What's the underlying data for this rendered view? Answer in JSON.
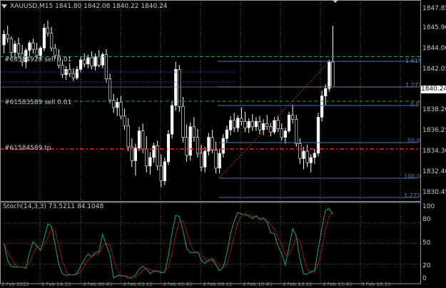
{
  "header": {
    "symbol_line": "XAUUSD,M15  1841.80 1842.08 1840.22 1840.24",
    "menu_icon": "triangle-down-icon"
  },
  "price_axis": {
    "labels": [
      "1847.85",
      "1845.90",
      "1844.00",
      "1842.05",
      "1840.24",
      "1838.20",
      "1836.25",
      "1834.30",
      "1832.40",
      "1830.45"
    ],
    "current_price": "1840.24"
  },
  "orders": [
    {
      "label": "#63584920 sell 0.01",
      "price": 1843.1,
      "color": "#2e9b4d"
    },
    {
      "label": "#61583589 sell 0.01",
      "price": 1838.9,
      "color": "#2e9b4d"
    },
    {
      "label": "#61584589 tp",
      "price": 1834.4,
      "color": "#ff2020"
    }
  ],
  "fibo": {
    "levels": [
      "1.618",
      "1.272",
      "0.0",
      "50.0",
      "100.0",
      "1.272"
    ],
    "color": "#4a6fb0"
  },
  "indicator": {
    "title": "Stoch(14,3,3) 73.5211 84.1048",
    "axis_labels": [
      "100",
      "80",
      "50",
      "20",
      "0"
    ],
    "main_color": "#20a080",
    "signal_color": "#d02020"
  },
  "time_axis": {
    "labels": [
      "2 Feb 2022",
      "2 Feb 14:15",
      "3 Feb 00:45",
      "3 Feb 03:15",
      "3 Feb 05:45",
      "3 Feb 08:15",
      "3 Feb 10:45",
      "3 Feb 13:15",
      "3 Feb 15:45",
      "3 Feb 18:15"
    ]
  },
  "chart_data": {
    "type": "candlestick",
    "symbol": "XAUUSD",
    "timeframe": "M15",
    "ylim": [
      1829.5,
      1848.3
    ],
    "candles": [
      [
        1844.2,
        1845.6,
        1843.4,
        1845.2
      ],
      [
        1845.2,
        1846.0,
        1844.4,
        1844.8
      ],
      [
        1844.8,
        1845.0,
        1843.0,
        1843.5
      ],
      [
        1843.5,
        1844.6,
        1842.8,
        1844.3
      ],
      [
        1844.3,
        1844.9,
        1843.0,
        1843.4
      ],
      [
        1843.4,
        1844.2,
        1842.2,
        1842.6
      ],
      [
        1842.6,
        1843.9,
        1842.0,
        1843.7
      ],
      [
        1843.7,
        1844.6,
        1843.1,
        1844.4
      ],
      [
        1844.4,
        1844.8,
        1843.4,
        1843.8
      ],
      [
        1843.8,
        1844.4,
        1842.9,
        1843.2
      ],
      [
        1843.2,
        1844.1,
        1842.8,
        1843.9
      ],
      [
        1843.9,
        1846.2,
        1843.6,
        1845.8
      ],
      [
        1845.8,
        1846.5,
        1845.0,
        1845.3
      ],
      [
        1845.3,
        1845.9,
        1843.6,
        1843.9
      ],
      [
        1843.9,
        1844.3,
        1842.9,
        1843.2
      ],
      [
        1843.2,
        1843.8,
        1842.0,
        1842.3
      ],
      [
        1842.3,
        1842.8,
        1841.1,
        1841.4
      ],
      [
        1841.4,
        1842.2,
        1840.9,
        1841.9
      ],
      [
        1841.9,
        1842.5,
        1841.2,
        1841.5
      ],
      [
        1841.5,
        1842.0,
        1840.8,
        1841.1
      ],
      [
        1841.1,
        1842.2,
        1840.9,
        1841.9
      ],
      [
        1841.9,
        1843.1,
        1841.6,
        1842.8
      ],
      [
        1842.8,
        1843.4,
        1842.1,
        1842.4
      ],
      [
        1842.4,
        1843.3,
        1842.0,
        1843.0
      ],
      [
        1843.0,
        1843.6,
        1841.9,
        1842.2
      ],
      [
        1842.2,
        1843.4,
        1841.8,
        1843.1
      ],
      [
        1843.1,
        1843.7,
        1842.1,
        1842.3
      ],
      [
        1842.3,
        1843.5,
        1842.0,
        1843.3
      ],
      [
        1843.3,
        1843.8,
        1840.6,
        1841.0
      ],
      [
        1841.0,
        1841.5,
        1838.7,
        1839.0
      ],
      [
        1839.0,
        1839.6,
        1837.8,
        1838.3
      ],
      [
        1838.3,
        1839.2,
        1837.5,
        1838.8
      ],
      [
        1838.8,
        1839.4,
        1837.2,
        1837.5
      ],
      [
        1837.5,
        1838.2,
        1836.2,
        1836.6
      ],
      [
        1836.6,
        1837.3,
        1834.2,
        1834.6
      ],
      [
        1834.6,
        1835.4,
        1832.7,
        1833.3
      ],
      [
        1833.3,
        1834.9,
        1831.9,
        1834.5
      ],
      [
        1834.5,
        1836.5,
        1834.2,
        1836.1
      ],
      [
        1836.1,
        1836.8,
        1834.0,
        1834.4
      ],
      [
        1834.4,
        1835.6,
        1832.2,
        1832.8
      ],
      [
        1832.8,
        1834.1,
        1832.0,
        1833.6
      ],
      [
        1833.6,
        1835.0,
        1833.1,
        1834.7
      ],
      [
        1834.7,
        1835.2,
        1832.4,
        1832.8
      ],
      [
        1832.8,
        1833.9,
        1830.8,
        1831.4
      ],
      [
        1831.4,
        1833.6,
        1831.0,
        1833.2
      ],
      [
        1833.2,
        1836.2,
        1832.9,
        1835.8
      ],
      [
        1835.8,
        1838.9,
        1835.4,
        1838.5
      ],
      [
        1838.5,
        1842.6,
        1838.0,
        1841.9
      ],
      [
        1841.9,
        1842.3,
        1837.9,
        1838.4
      ],
      [
        1838.4,
        1839.3,
        1835.0,
        1835.5
      ],
      [
        1835.5,
        1836.7,
        1833.2,
        1833.8
      ],
      [
        1833.8,
        1836.9,
        1833.3,
        1836.5
      ],
      [
        1836.5,
        1837.4,
        1835.1,
        1835.5
      ],
      [
        1835.5,
        1836.3,
        1833.6,
        1834.0
      ],
      [
        1834.0,
        1834.8,
        1832.3,
        1832.7
      ],
      [
        1832.7,
        1834.6,
        1832.2,
        1834.2
      ],
      [
        1834.2,
        1835.9,
        1833.8,
        1835.5
      ],
      [
        1835.5,
        1836.2,
        1834.0,
        1834.3
      ],
      [
        1834.3,
        1835.1,
        1832.1,
        1832.6
      ],
      [
        1832.6,
        1834.4,
        1832.1,
        1834.0
      ],
      [
        1834.0,
        1835.8,
        1833.6,
        1835.4
      ],
      [
        1835.4,
        1836.6,
        1835.0,
        1836.2
      ],
      [
        1836.2,
        1837.5,
        1835.7,
        1837.1
      ],
      [
        1837.1,
        1837.8,
        1836.0,
        1836.4
      ],
      [
        1836.4,
        1837.6,
        1836.0,
        1837.3
      ],
      [
        1837.3,
        1838.3,
        1836.6,
        1837.0
      ],
      [
        1837.0,
        1837.9,
        1836.0,
        1836.4
      ],
      [
        1836.4,
        1837.3,
        1835.9,
        1837.0
      ],
      [
        1837.0,
        1837.7,
        1836.1,
        1836.5
      ],
      [
        1836.5,
        1837.4,
        1836.1,
        1837.0
      ],
      [
        1837.0,
        1837.5,
        1835.8,
        1836.2
      ],
      [
        1836.2,
        1837.2,
        1835.7,
        1836.8
      ],
      [
        1836.8,
        1837.6,
        1836.2,
        1836.5
      ],
      [
        1836.5,
        1836.9,
        1835.6,
        1836.0
      ],
      [
        1836.0,
        1837.4,
        1835.8,
        1837.1
      ],
      [
        1837.1,
        1837.5,
        1836.0,
        1836.3
      ],
      [
        1836.3,
        1836.8,
        1835.2,
        1835.5
      ],
      [
        1835.5,
        1836.4,
        1834.9,
        1836.1
      ],
      [
        1836.1,
        1837.9,
        1835.9,
        1837.6
      ],
      [
        1837.6,
        1838.6,
        1836.8,
        1837.2
      ],
      [
        1837.2,
        1837.6,
        1834.6,
        1834.9
      ],
      [
        1834.9,
        1835.4,
        1833.0,
        1833.5
      ],
      [
        1833.5,
        1834.6,
        1832.5,
        1834.2
      ],
      [
        1834.2,
        1834.8,
        1832.7,
        1833.1
      ],
      [
        1833.1,
        1833.9,
        1832.2,
        1833.6
      ],
      [
        1833.6,
        1834.4,
        1833.0,
        1834.0
      ],
      [
        1834.0,
        1837.8,
        1833.7,
        1837.4
      ],
      [
        1837.4,
        1839.9,
        1837.0,
        1839.4
      ],
      [
        1839.4,
        1840.5,
        1838.5,
        1840.1
      ],
      [
        1840.1,
        1842.8,
        1839.8,
        1842.6
      ],
      [
        1842.6,
        1846.0,
        1842.0,
        1840.24
      ]
    ]
  }
}
